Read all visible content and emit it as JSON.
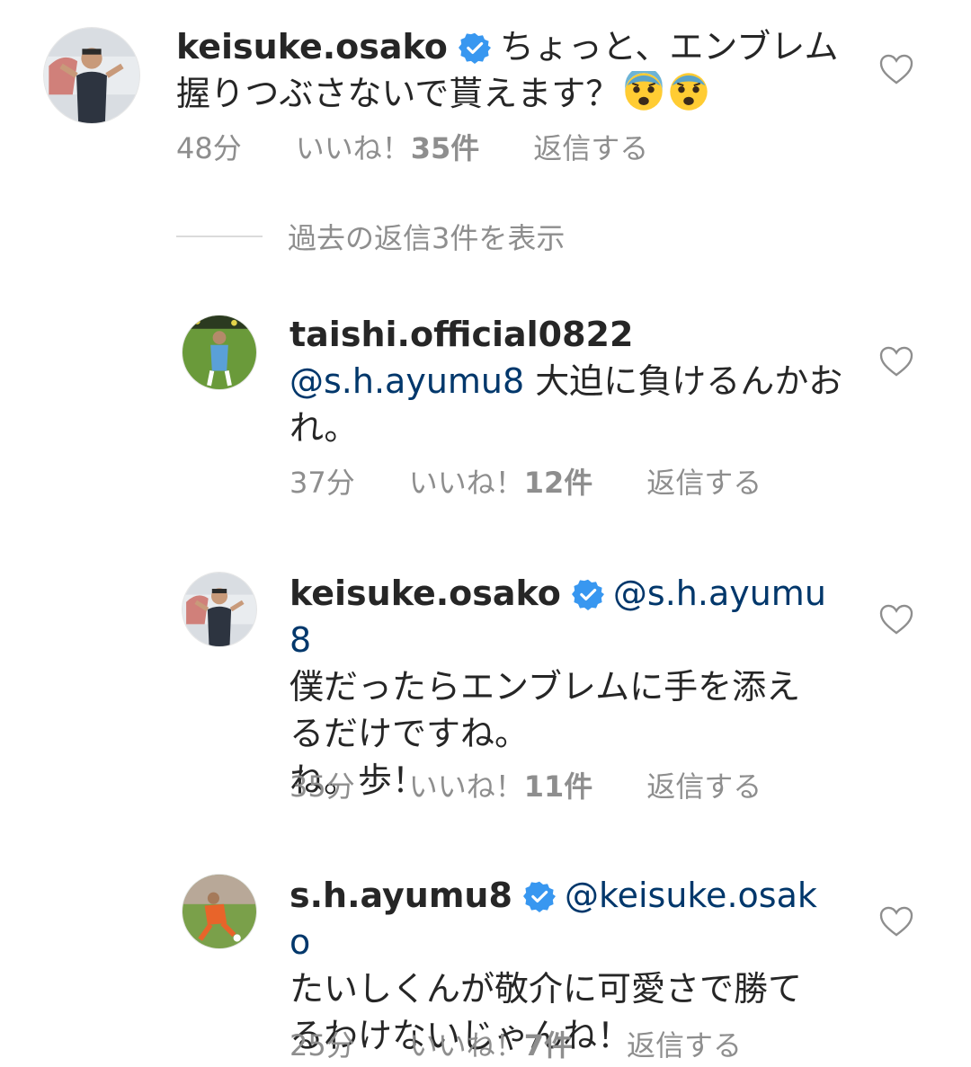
{
  "comments": [
    {
      "username": "keisuke.osako",
      "verified": true,
      "mention": "",
      "text": "ちょっと、エンブレム握りつぶさないで貰えます？",
      "emoji_count": 2,
      "time": "48分",
      "likes_label": "いいね！",
      "likes_count": "35件",
      "reply": "返信する"
    },
    {
      "username": "taishi.official0822",
      "verified": false,
      "mention": "@s.h.ayumu8",
      "text": "大迫に負けるんかおれ。",
      "time": "37分",
      "likes_label": "いいね！",
      "likes_count": "12件",
      "reply": "返信する"
    },
    {
      "username": "keisuke.osako",
      "verified": true,
      "mention": "@s.h.ayumu8",
      "text_line1": "僕だったらエンブレムに手を添えるだけですね。",
      "text_line2": "ね。歩！",
      "time": "35分",
      "likes_label": "いいね！",
      "likes_count": "11件",
      "reply": "返信する"
    },
    {
      "username": "s.h.ayumu8",
      "verified": true,
      "mention": "@keisuke.osako",
      "text": "たいしくんが敬介に可愛さで勝てるわけないじゃんね！",
      "time": "25分",
      "likes_label": "いいね！",
      "likes_count": "7件",
      "reply": "返信する"
    }
  ],
  "view_replies": "過去の返信3件を表示",
  "colors": {
    "text": "#262626",
    "meta": "#8e8e8e",
    "mention": "#00376b",
    "verified": "#3897f0"
  },
  "icons": {
    "verified": "verified-badge-icon",
    "heart": "heart-outline-icon",
    "emoji": "anxious-face-emoji"
  }
}
